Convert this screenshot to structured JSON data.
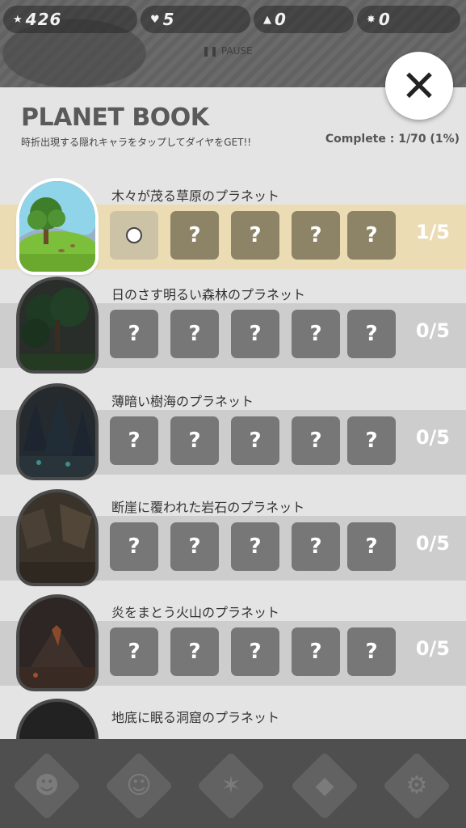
{
  "hud": {
    "stars": "426",
    "hearts": "5",
    "triangles": "0",
    "gears": "0",
    "pause_label": "❚❚ PAUSE"
  },
  "panel": {
    "title": "PLANET BOOK",
    "subtitle": "時折出現する隠れキャラをタップしてダイヤをGET!!",
    "complete": "Complete : 1/70 (1%)",
    "close_label": "✕"
  },
  "planets": [
    {
      "name": "木々が茂る草原のプラネット",
      "count": "1/5",
      "slots": [
        "",
        "?",
        "?",
        "?",
        "?"
      ]
    },
    {
      "name": "日のさす明るい森林のプラネット",
      "count": "0/5",
      "slots": [
        "?",
        "?",
        "?",
        "?",
        "?"
      ]
    },
    {
      "name": "薄暗い樹海のプラネット",
      "count": "0/5",
      "slots": [
        "?",
        "?",
        "?",
        "?",
        "?"
      ]
    },
    {
      "name": "断崖に覆われた岩石のプラネット",
      "count": "0/5",
      "slots": [
        "?",
        "?",
        "?",
        "?",
        "?"
      ]
    },
    {
      "name": "炎をまとう火山のプラネット",
      "count": "0/5",
      "slots": [
        "?",
        "?",
        "?",
        "?",
        "?"
      ]
    },
    {
      "name": "地底に眠る洞窟のプラネット"
    }
  ],
  "nav": [
    "character-icon",
    "creature-icon",
    "star-badge-icon",
    "diamond-icon",
    "gear-icon"
  ],
  "colors": {
    "active_band": "#ebdcb4",
    "band": "#cdcdcd",
    "slot": "#777777"
  }
}
